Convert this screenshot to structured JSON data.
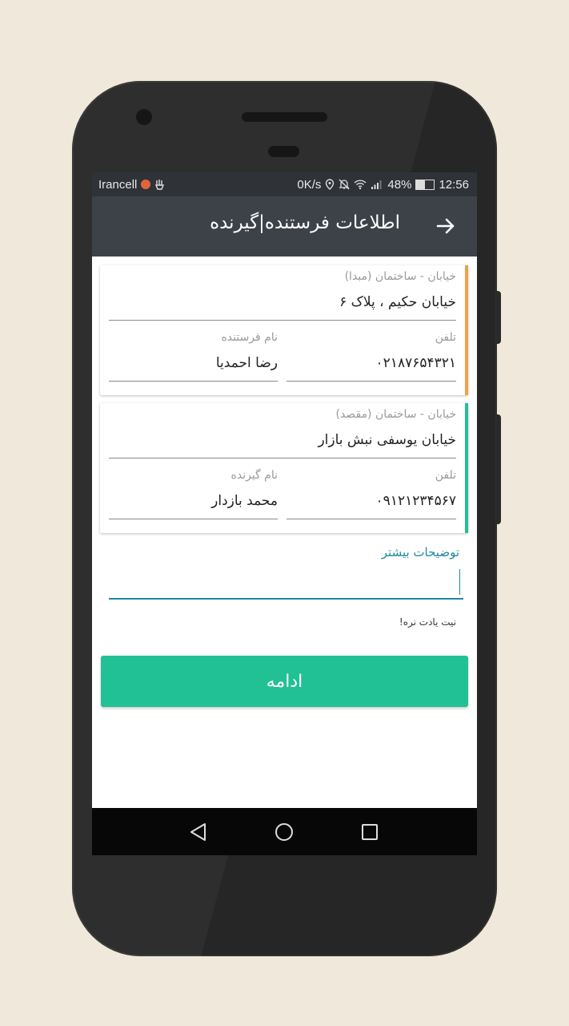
{
  "status_bar": {
    "carrier": "Irancell",
    "speed": "0K/s",
    "battery": "48%",
    "battery_level": 0.48,
    "time": "12:56"
  },
  "app_bar": {
    "title": "اطلاعات فرستنده|گیرنده",
    "back_icon": "arrow-right-icon"
  },
  "origin_card": {
    "accent_color": "#f0a04b",
    "address_label": "خیابان - ساختمان (مبدا)",
    "address_value": "خیابان حکیم ، پلاک ۶",
    "phone_label": "تلفن",
    "phone_value": "۰۲۱۸۷۶۵۴۳۲۱",
    "name_label": "نام فرستنده",
    "name_value": "رضا احمدیا"
  },
  "destination_card": {
    "accent_color": "#22c095",
    "address_label": "خیابان - ساختمان (مقصد)",
    "address_value": "خیابان یوسفی نبش بازار",
    "phone_label": "تلفن",
    "phone_value": "۰۹۱۲۱۲۳۴۵۶۷",
    "name_label": "نام گیرنده",
    "name_value": "محمد بازدار"
  },
  "notes": {
    "label": "توضیحات بیشتر",
    "value": "",
    "hint": "نیت یادت نره!"
  },
  "continue_button": {
    "label": "ادامه",
    "color": "#22c095"
  },
  "nav_bar": {
    "back_icon": "triangle-back-icon",
    "home_icon": "circle-home-icon",
    "recents_icon": "square-recents-icon"
  }
}
